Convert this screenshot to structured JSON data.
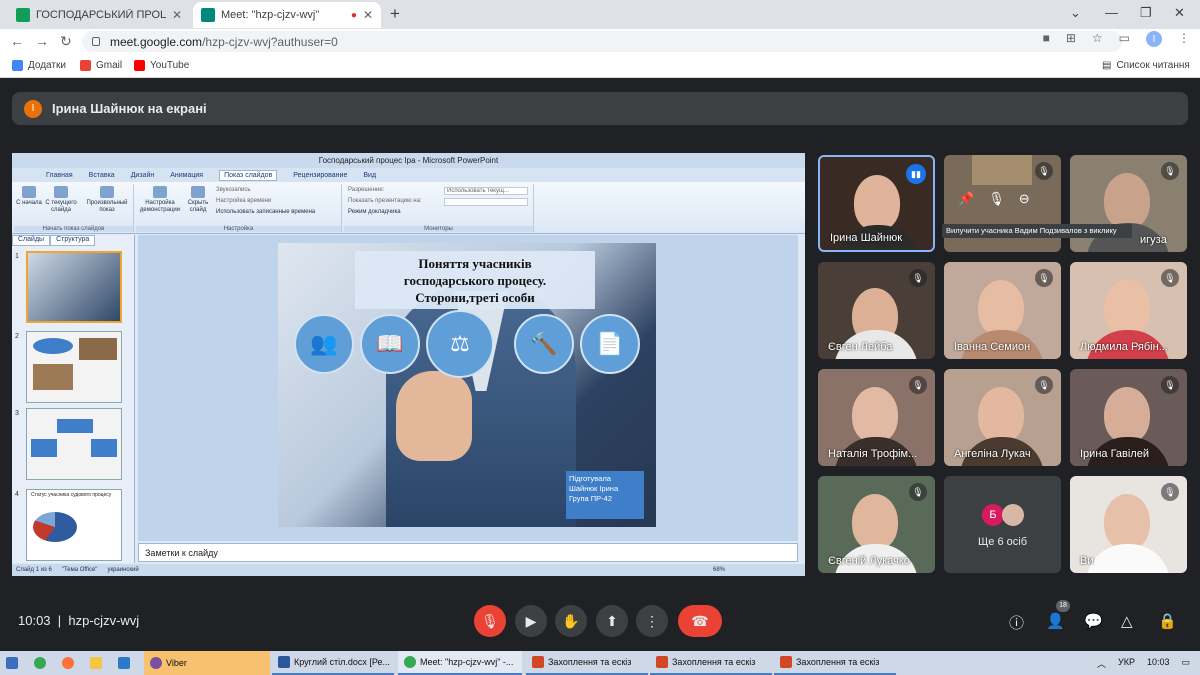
{
  "browser": {
    "tabs": [
      {
        "title": "ГОСПОДАРСЬКИЙ ПРОЦЕС Пр",
        "icon": "sheets-icon",
        "color": "#0f9d58"
      },
      {
        "title": "Meet: \"hzp-cjzv-wvj\"",
        "icon": "meet-icon",
        "color": "#00897b"
      }
    ],
    "url_host": "meet.google.com",
    "url_path": "/hzp-cjzv-wvj?authuser=0",
    "profile_initial": "I",
    "bookmarks": [
      {
        "label": "Додатки",
        "color": "#4285f4"
      },
      {
        "label": "Gmail",
        "color": "#ea4335"
      },
      {
        "label": "YouTube",
        "color": "#ff0000"
      }
    ],
    "reading_list": "Список читання"
  },
  "meet": {
    "presenter_initial": "І",
    "presenting_banner": "Ірина Шайнюк на екрані",
    "meeting_time": "10:03",
    "meeting_code": "hzp-cjzv-wvj",
    "participants_count": "18",
    "tooltip": "Вилучити учасника Вадим Подзивалов з виклику",
    "more_label": "Ще 6 осіб",
    "more_initial": "Б",
    "participants": [
      {
        "name": "Ірина Шайнюк",
        "bg": "#3a2a24"
      },
      {
        "name": "",
        "bg": "#7a6a5a"
      },
      {
        "name": "игуза",
        "bg": "#8a8070"
      },
      {
        "name": "Євген Лейба",
        "bg": "#4a3f38"
      },
      {
        "name": "Іванна Семион",
        "bg": "#c0a89a"
      },
      {
        "name": "Людмила Рябін...",
        "bg": "#d8c0b0"
      },
      {
        "name": "Наталія Трофім...",
        "bg": "#8a7268"
      },
      {
        "name": "Ангеліна Лукач",
        "bg": "#b8a090"
      },
      {
        "name": "Ірина Гавілей",
        "bg": "#6a5a58"
      },
      {
        "name": "Євгеній Лукачко",
        "bg": "#5a6a58"
      },
      {
        "name": "Ви",
        "bg": "#e8e4e0"
      }
    ]
  },
  "powerpoint": {
    "window_title": "Господарський процес Іра - Microsoft PowerPoint",
    "ribbon_tabs": [
      "Главная",
      "Вставка",
      "Дизайн",
      "Анимация",
      "Показ слайдов",
      "Рецензирование",
      "Вид"
    ],
    "active_tab": "Показ слайдов",
    "group1": {
      "label": "Начать показ слайдов",
      "b1": "С начала",
      "b2": "С текущего слайда",
      "b3": "Произвольный показ"
    },
    "group2": {
      "label": "Настройка",
      "b1": "Настройка демонстрации",
      "b2": "Скрыть слайд",
      "r1": "Звукозапись",
      "r2": "Настройка времени",
      "r3": "Использовать записанные времена"
    },
    "group3": {
      "label": "Мониторы",
      "r1": "Разрешение:",
      "r2": "Показать презентацию на:",
      "r3": "Режим докладчика",
      "v1": "Использовать текущ..."
    },
    "panel_tabs": [
      "Слайды",
      "Структура"
    ],
    "slide_title_lines": [
      "Поняття учасників",
      "господарського процесу.",
      "Сторони,треті особи"
    ],
    "credit_lines": [
      "Підготувала",
      "Шайнюк Ірина",
      "Група ПР-42"
    ],
    "notes": "Заметки к слайду",
    "status": [
      "Слайд 1 из 6",
      "\"Тема Office\"",
      "украинский"
    ],
    "zoom": "68%",
    "thumb4_title": "Статус учасника судового процесу"
  },
  "taskbar": {
    "items": [
      "Viber",
      "Круглий стіл.docx [Ре...",
      "Meet: \"hzp-cjzv-wvj\" -...",
      "Захоплення та ескіз",
      "Захоплення та ескіз",
      "Захоплення та ескіз"
    ],
    "lang": "УКР",
    "time": "10:03"
  }
}
